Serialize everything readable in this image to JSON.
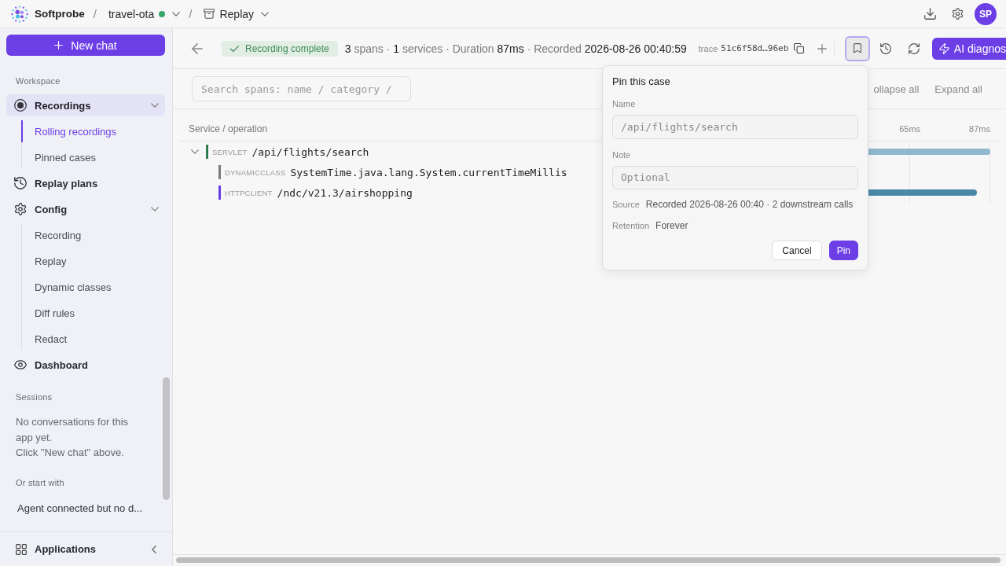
{
  "top_bar": {
    "brand": "Softprobe",
    "breadcrumbs": [
      {
        "kind": "separator",
        "label": "/"
      },
      {
        "kind": "app",
        "label": "travel-ota",
        "online": true
      },
      {
        "kind": "separator",
        "label": "/"
      },
      {
        "kind": "page",
        "label": "Replay"
      }
    ],
    "avatar": "SP"
  },
  "sidebar": {
    "new_chat": "New chat",
    "section": "Workspace",
    "items": [
      {
        "label": "Recordings",
        "selected": true,
        "expanded": true,
        "children": [
          {
            "label": "Rolling recordings",
            "selected": true
          },
          {
            "label": "Pinned cases",
            "selected": false
          }
        ]
      },
      {
        "label": "Replay plans",
        "selected": false
      },
      {
        "label": "Config",
        "selected": false,
        "expanded": true,
        "children": [
          {
            "label": "Recording",
            "selected": false
          },
          {
            "label": "Replay",
            "selected": false
          },
          {
            "label": "Dynamic classes",
            "selected": false
          },
          {
            "label": "Diff rules",
            "selected": false
          },
          {
            "label": "Redact",
            "selected": false
          }
        ]
      },
      {
        "label": "Dashboard",
        "selected": false
      }
    ],
    "sessions": {
      "title": "Sessions",
      "empty_text": [
        "No conversations for this app yet.",
        "Click \"New chat\" above."
      ],
      "start_label": "Or start with",
      "suggestions": [
        "Agent connected but no d..."
      ]
    },
    "footer": "Applications"
  },
  "toolbar": {
    "status": "Recording complete",
    "summary": "**3** spans · **1** services · Duration **87ms** · Recorded **2026-08-26 00:40:59**",
    "trace": {
      "label": "trace",
      "id": "51c6f58d…96eb"
    },
    "pin_button": {
      "pressed": true
    },
    "ai_button": "AI diagnos"
  },
  "filter_bar": {
    "search": {
      "placeholder": "Search spans: name / category /"
    },
    "actions": [
      "ollapse all",
      "Expand all"
    ]
  },
  "spans": {
    "column": "Service / operation",
    "ticks": [
      "65ms",
      "87ms"
    ],
    "rows": [
      {
        "category": "SERVLET",
        "name": "/api/flights/search",
        "color": "#2f7d4f",
        "expanded": true,
        "level": 1,
        "children": [
          {
            "category": "DYNAMICCLASS",
            "name": "SystemTime.java.lang.System.currentTimeMillis",
            "color": "#7a7a7a"
          },
          {
            "category": "HTTPCLIENT",
            "name": "/ndc/v21.3/airshopping",
            "color": "#6a3de8",
            "level": 0.96
          }
        ]
      }
    ]
  },
  "pin_popover": {
    "title": "Pin this case",
    "fields": [
      {
        "label": "Name",
        "placeholder": "/api/flights/search"
      },
      {
        "label": "Note",
        "placeholder": "Optional"
      }
    ],
    "details": [
      {
        "label": "Source",
        "value": "Recorded 2026-08-26 00:40 · 2 downstream calls"
      },
      {
        "label": "Retention",
        "value": "Forever"
      }
    ],
    "buttons": [
      {
        "label": "Cancel",
        "kind": "secondary"
      },
      {
        "label": "Pin",
        "kind": "primary"
      }
    ]
  }
}
